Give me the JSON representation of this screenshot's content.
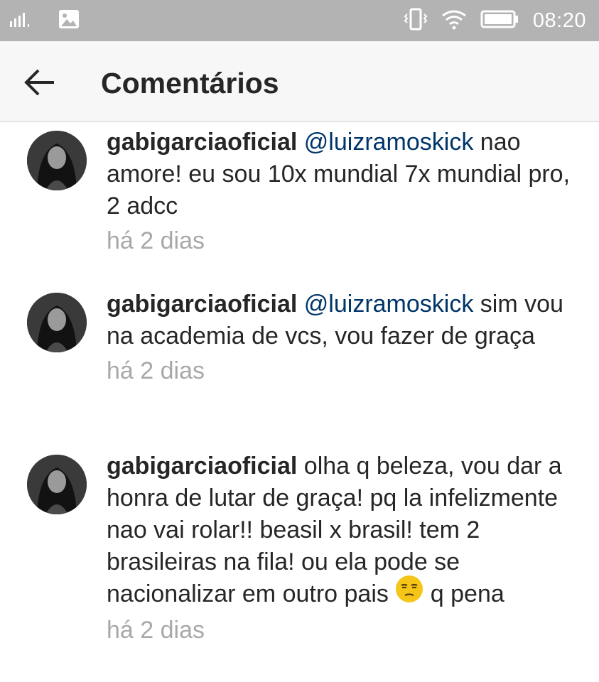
{
  "status_bar": {
    "time": "08:20"
  },
  "header": {
    "title": "Comentários"
  },
  "comments": [
    {
      "username": "gabigarciaoficial",
      "mention": "@luizramoskick",
      "text": " nao amore! eu sou 10x mundial 7x mundial pro, 2 adcc",
      "time": "há 2 dias"
    },
    {
      "username": "gabigarciaoficial",
      "mention": "@luizramoskick",
      "text": " sim vou na academia de vcs, vou fazer de graça",
      "time": "há 2 dias"
    },
    {
      "username": "gabigarciaoficial",
      "mention": "",
      "text": " olha q beleza, vou dar a honra de lutar de graça! pq la infelizmente nao vai rolar!! beasil x brasil! tem 2 brasileiras na fila! ou ela pode se nacionalizar em outro pais ",
      "emoji": "unamused-face-icon",
      "text_after_emoji": " q pena",
      "time": "há 2 dias"
    }
  ]
}
